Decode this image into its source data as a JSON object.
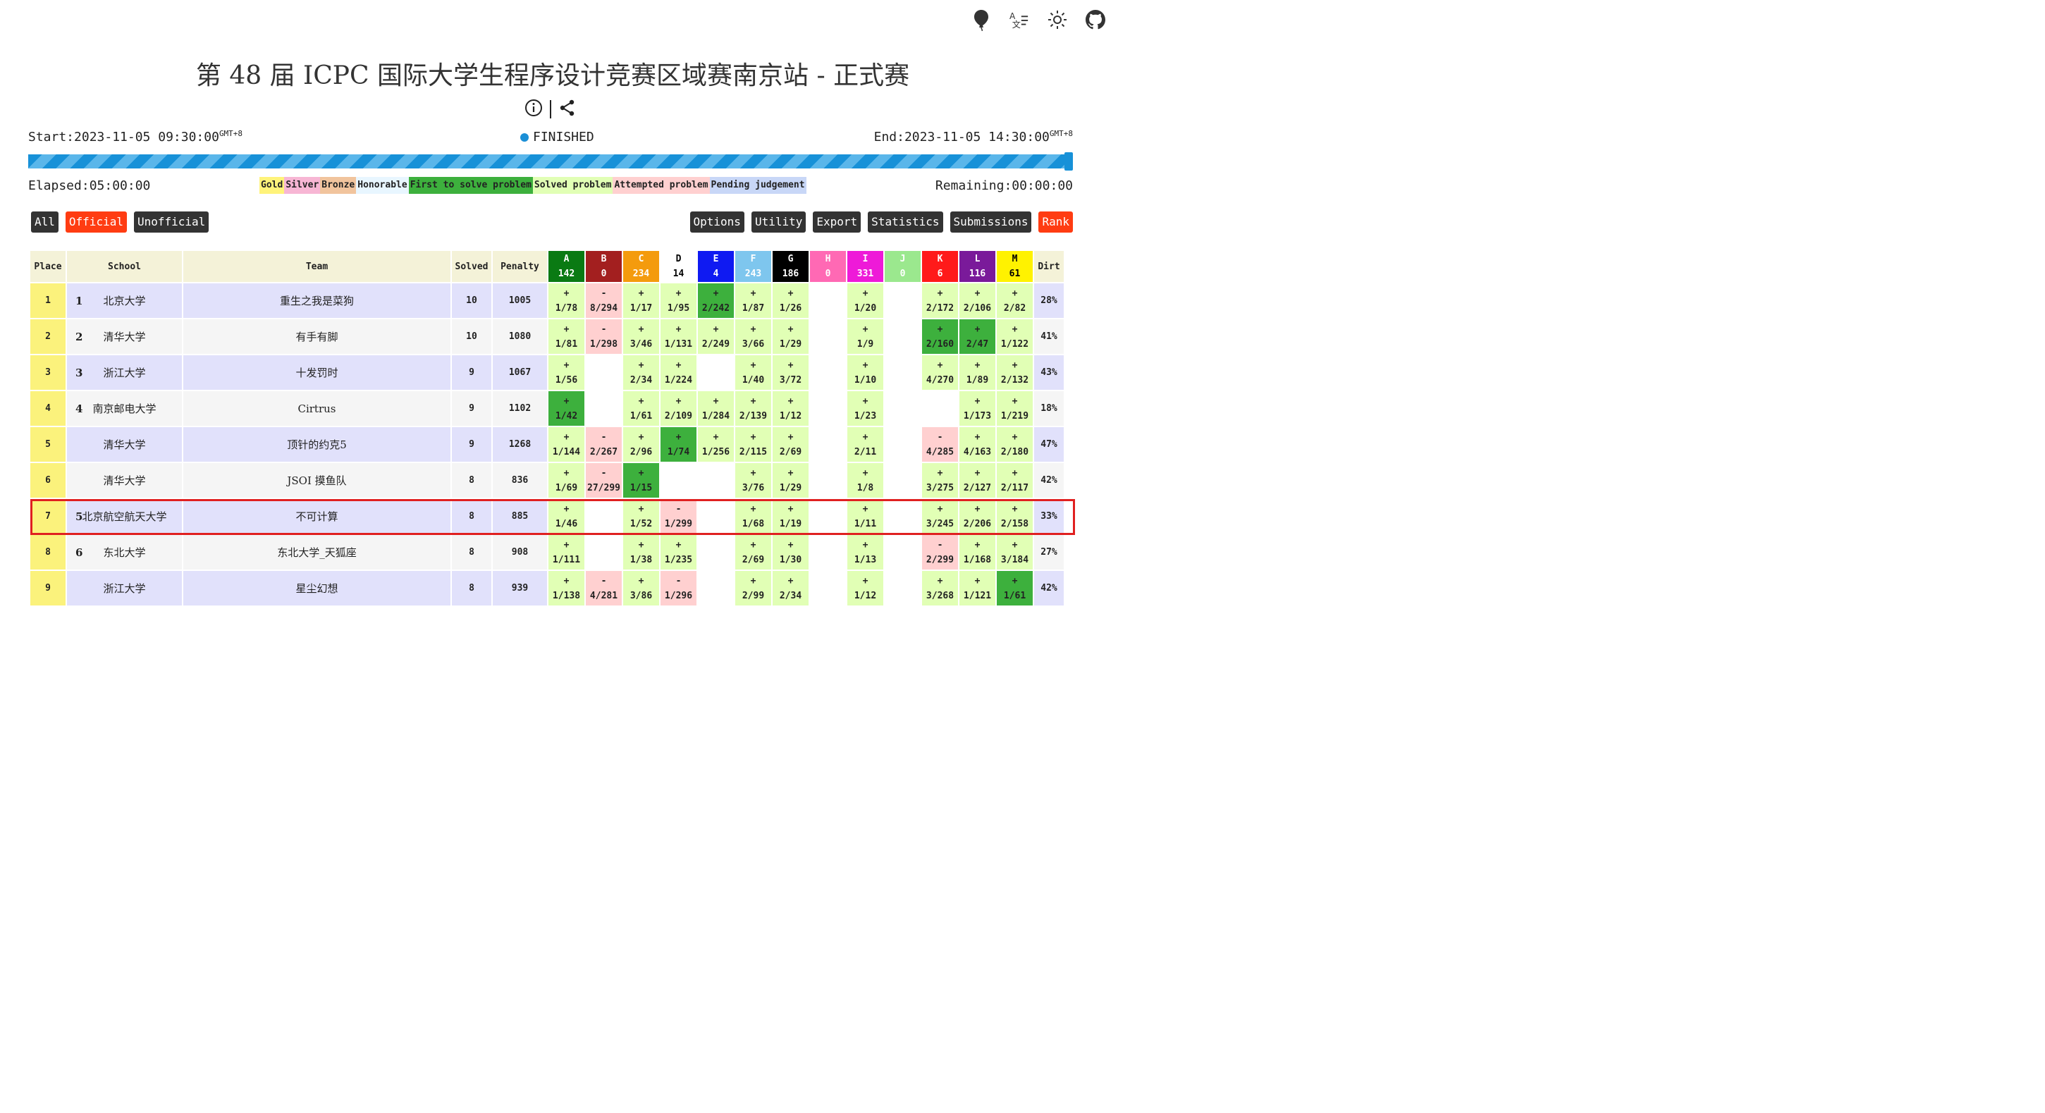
{
  "contest": {
    "title": "第 48 届 ICPC 国际大学生程序设计竞赛区域赛南京站 - 正式赛",
    "start": "Start:2023-11-05 09:30:00",
    "end": "End:2023-11-05 14:30:00",
    "tz": "GMT+8",
    "status": "FINISHED",
    "elapsed": "Elapsed:05:00:00",
    "remaining": "Remaining:00:00:00",
    "progress_fraction": 1.0
  },
  "header_icons": [
    "balloon-icon",
    "translate-icon",
    "sun-icon",
    "github-icon"
  ],
  "legend": [
    {
      "label": "Gold",
      "bg": "#fff37a"
    },
    {
      "label": "Silver",
      "bg": "#f7b6d4"
    },
    {
      "label": "Bronze",
      "bg": "#f1c49d"
    },
    {
      "label": "Honorable",
      "bg": "#e8f6ff"
    },
    {
      "label": "First to solve problem",
      "bg": "#3db03d"
    },
    {
      "label": "Solved problem",
      "bg": "#e1ffb5"
    },
    {
      "label": "Attempted problem",
      "bg": "#ffd0d0"
    },
    {
      "label": "Pending judgement",
      "bg": "#c8d7f7"
    }
  ],
  "filters": [
    "All",
    "Official",
    "Unofficial"
  ],
  "active_filter": "Official",
  "actions": [
    "Options",
    "Utility",
    "Export",
    "Statistics",
    "Submissions",
    "Rank"
  ],
  "active_action": "Rank",
  "table": {
    "headers": {
      "place": "Place",
      "school": "School",
      "team": "Team",
      "solved": "Solved",
      "penalty": "Penalty",
      "dirt": "Dirt"
    },
    "problems": [
      {
        "id": "A",
        "count": "142",
        "bg": "#0a7a13",
        "fg": "#ffffff"
      },
      {
        "id": "B",
        "count": "0",
        "bg": "#a31f1f",
        "fg": "#ffffff"
      },
      {
        "id": "C",
        "count": "234",
        "bg": "#f49b0d",
        "fg": "#ffffff"
      },
      {
        "id": "D",
        "count": "14",
        "bg": "#ffffff",
        "fg": "#000000"
      },
      {
        "id": "E",
        "count": "4",
        "bg": "#0f1af2",
        "fg": "#ffffff"
      },
      {
        "id": "F",
        "count": "243",
        "bg": "#7ec6ee",
        "fg": "#ffffff"
      },
      {
        "id": "G",
        "count": "186",
        "bg": "#000000",
        "fg": "#ffffff"
      },
      {
        "id": "H",
        "count": "0",
        "bg": "#ff69b4",
        "fg": "#ffffff"
      },
      {
        "id": "I",
        "count": "331",
        "bg": "#ee1ad8",
        "fg": "#ffffff"
      },
      {
        "id": "J",
        "count": "0",
        "bg": "#9be88e",
        "fg": "#ffffff"
      },
      {
        "id": "K",
        "count": "6",
        "bg": "#ff1a1a",
        "fg": "#ffffff"
      },
      {
        "id": "L",
        "count": "116",
        "bg": "#7a1a9a",
        "fg": "#ffffff"
      },
      {
        "id": "M",
        "count": "61",
        "bg": "#fff200",
        "fg": "#000000"
      }
    ],
    "rows": [
      {
        "place": "1",
        "srank": "1",
        "school": "北京大学",
        "team": "重生之我是菜狗",
        "solved": "10",
        "penalty": "1005",
        "dirt": "28%",
        "cells": [
          [
            "s",
            "+",
            "1/78"
          ],
          [
            "a",
            "-",
            "8/294"
          ],
          [
            "s",
            "+",
            "1/17"
          ],
          [
            "s",
            "+",
            "1/95"
          ],
          [
            "f",
            "+",
            "2/242"
          ],
          [
            "s",
            "+",
            "1/87"
          ],
          [
            "s",
            "+",
            "1/26"
          ],
          [
            "e",
            "",
            ""
          ],
          [
            "s",
            "+",
            "1/20"
          ],
          [
            "e",
            "",
            ""
          ],
          [
            "s",
            "+",
            "2/172"
          ],
          [
            "s",
            "+",
            "2/106"
          ],
          [
            "s",
            "+",
            "2/82"
          ]
        ]
      },
      {
        "place": "2",
        "srank": "2",
        "school": "清华大学",
        "team": "有手有脚",
        "solved": "10",
        "penalty": "1080",
        "dirt": "41%",
        "cells": [
          [
            "s",
            "+",
            "1/81"
          ],
          [
            "a",
            "-",
            "1/298"
          ],
          [
            "s",
            "+",
            "3/46"
          ],
          [
            "s",
            "+",
            "1/131"
          ],
          [
            "s",
            "+",
            "2/249"
          ],
          [
            "s",
            "+",
            "3/66"
          ],
          [
            "s",
            "+",
            "1/29"
          ],
          [
            "e",
            "",
            ""
          ],
          [
            "s",
            "+",
            "1/9"
          ],
          [
            "e",
            "",
            ""
          ],
          [
            "f",
            "+",
            "2/160"
          ],
          [
            "f",
            "+",
            "2/47"
          ],
          [
            "s",
            "+",
            "1/122"
          ]
        ]
      },
      {
        "place": "3",
        "srank": "3",
        "school": "浙江大学",
        "team": "十发罚时",
        "solved": "9",
        "penalty": "1067",
        "dirt": "43%",
        "cells": [
          [
            "s",
            "+",
            "1/56"
          ],
          [
            "e",
            "",
            ""
          ],
          [
            "s",
            "+",
            "2/34"
          ],
          [
            "s",
            "+",
            "1/224"
          ],
          [
            "e",
            "",
            ""
          ],
          [
            "s",
            "+",
            "1/40"
          ],
          [
            "s",
            "+",
            "3/72"
          ],
          [
            "e",
            "",
            ""
          ],
          [
            "s",
            "+",
            "1/10"
          ],
          [
            "e",
            "",
            ""
          ],
          [
            "s",
            "+",
            "4/270"
          ],
          [
            "s",
            "+",
            "1/89"
          ],
          [
            "s",
            "+",
            "2/132"
          ]
        ]
      },
      {
        "place": "4",
        "srank": "4",
        "school": "南京邮电大学",
        "team": "Cirtrus",
        "solved": "9",
        "penalty": "1102",
        "dirt": "18%",
        "cells": [
          [
            "f",
            "+",
            "1/42"
          ],
          [
            "e",
            "",
            ""
          ],
          [
            "s",
            "+",
            "1/61"
          ],
          [
            "s",
            "+",
            "2/109"
          ],
          [
            "s",
            "+",
            "1/284"
          ],
          [
            "s",
            "+",
            "2/139"
          ],
          [
            "s",
            "+",
            "1/12"
          ],
          [
            "e",
            "",
            ""
          ],
          [
            "s",
            "+",
            "1/23"
          ],
          [
            "e",
            "",
            ""
          ],
          [
            "e",
            "",
            ""
          ],
          [
            "s",
            "+",
            "1/173"
          ],
          [
            "s",
            "+",
            "1/219"
          ]
        ]
      },
      {
        "place": "5",
        "srank": "",
        "school": "清华大学",
        "team": "顶针的约克5",
        "solved": "9",
        "penalty": "1268",
        "dirt": "47%",
        "cells": [
          [
            "s",
            "+",
            "1/144"
          ],
          [
            "a",
            "-",
            "2/267"
          ],
          [
            "s",
            "+",
            "2/96"
          ],
          [
            "f",
            "+",
            "1/74"
          ],
          [
            "s",
            "+",
            "1/256"
          ],
          [
            "s",
            "+",
            "2/115"
          ],
          [
            "s",
            "+",
            "2/69"
          ],
          [
            "e",
            "",
            ""
          ],
          [
            "s",
            "+",
            "2/11"
          ],
          [
            "e",
            "",
            ""
          ],
          [
            "a",
            "-",
            "4/285"
          ],
          [
            "s",
            "+",
            "4/163"
          ],
          [
            "s",
            "+",
            "2/180"
          ]
        ]
      },
      {
        "place": "6",
        "srank": "",
        "school": "清华大学",
        "team": "JSOI 摸鱼队",
        "solved": "8",
        "penalty": "836",
        "dirt": "42%",
        "cells": [
          [
            "s",
            "+",
            "1/69"
          ],
          [
            "a",
            "-",
            "27/299"
          ],
          [
            "f",
            "+",
            "1/15"
          ],
          [
            "e",
            "",
            ""
          ],
          [
            "e",
            "",
            ""
          ],
          [
            "s",
            "+",
            "3/76"
          ],
          [
            "s",
            "+",
            "1/29"
          ],
          [
            "e",
            "",
            ""
          ],
          [
            "s",
            "+",
            "1/8"
          ],
          [
            "e",
            "",
            ""
          ],
          [
            "s",
            "+",
            "3/275"
          ],
          [
            "s",
            "+",
            "2/127"
          ],
          [
            "s",
            "+",
            "2/117"
          ]
        ]
      },
      {
        "place": "7",
        "srank": "5",
        "school": "北京航空航天大学",
        "team": "不可计算",
        "solved": "8",
        "penalty": "885",
        "dirt": "33%",
        "cells": [
          [
            "s",
            "+",
            "1/46"
          ],
          [
            "e",
            "",
            ""
          ],
          [
            "s",
            "+",
            "1/52"
          ],
          [
            "a",
            "-",
            "1/299"
          ],
          [
            "e",
            "",
            ""
          ],
          [
            "s",
            "+",
            "1/68"
          ],
          [
            "s",
            "+",
            "1/19"
          ],
          [
            "e",
            "",
            ""
          ],
          [
            "s",
            "+",
            "1/11"
          ],
          [
            "e",
            "",
            ""
          ],
          [
            "s",
            "+",
            "3/245"
          ],
          [
            "s",
            "+",
            "2/206"
          ],
          [
            "s",
            "+",
            "2/158"
          ]
        ]
      },
      {
        "place": "8",
        "srank": "6",
        "school": "东北大学",
        "team": "东北大学_天狐座",
        "solved": "8",
        "penalty": "908",
        "dirt": "27%",
        "cells": [
          [
            "s",
            "+",
            "1/111"
          ],
          [
            "e",
            "",
            ""
          ],
          [
            "s",
            "+",
            "1/38"
          ],
          [
            "s",
            "+",
            "1/235"
          ],
          [
            "e",
            "",
            ""
          ],
          [
            "s",
            "+",
            "2/69"
          ],
          [
            "s",
            "+",
            "1/30"
          ],
          [
            "e",
            "",
            ""
          ],
          [
            "s",
            "+",
            "1/13"
          ],
          [
            "e",
            "",
            ""
          ],
          [
            "a",
            "-",
            "2/299"
          ],
          [
            "s",
            "+",
            "1/168"
          ],
          [
            "s",
            "+",
            "3/184"
          ]
        ]
      },
      {
        "place": "9",
        "srank": "",
        "school": "浙江大学",
        "team": "星尘幻想",
        "solved": "8",
        "penalty": "939",
        "dirt": "42%",
        "cells": [
          [
            "s",
            "+",
            "1/138"
          ],
          [
            "a",
            "-",
            "4/281"
          ],
          [
            "s",
            "+",
            "3/86"
          ],
          [
            "a",
            "-",
            "1/296"
          ],
          [
            "e",
            "",
            ""
          ],
          [
            "s",
            "+",
            "2/99"
          ],
          [
            "s",
            "+",
            "2/34"
          ],
          [
            "e",
            "",
            ""
          ],
          [
            "s",
            "+",
            "1/12"
          ],
          [
            "e",
            "",
            ""
          ],
          [
            "s",
            "+",
            "3/268"
          ],
          [
            "s",
            "+",
            "1/121"
          ],
          [
            "f",
            "+",
            "1/61"
          ]
        ]
      }
    ]
  },
  "highlighted_row": "7"
}
